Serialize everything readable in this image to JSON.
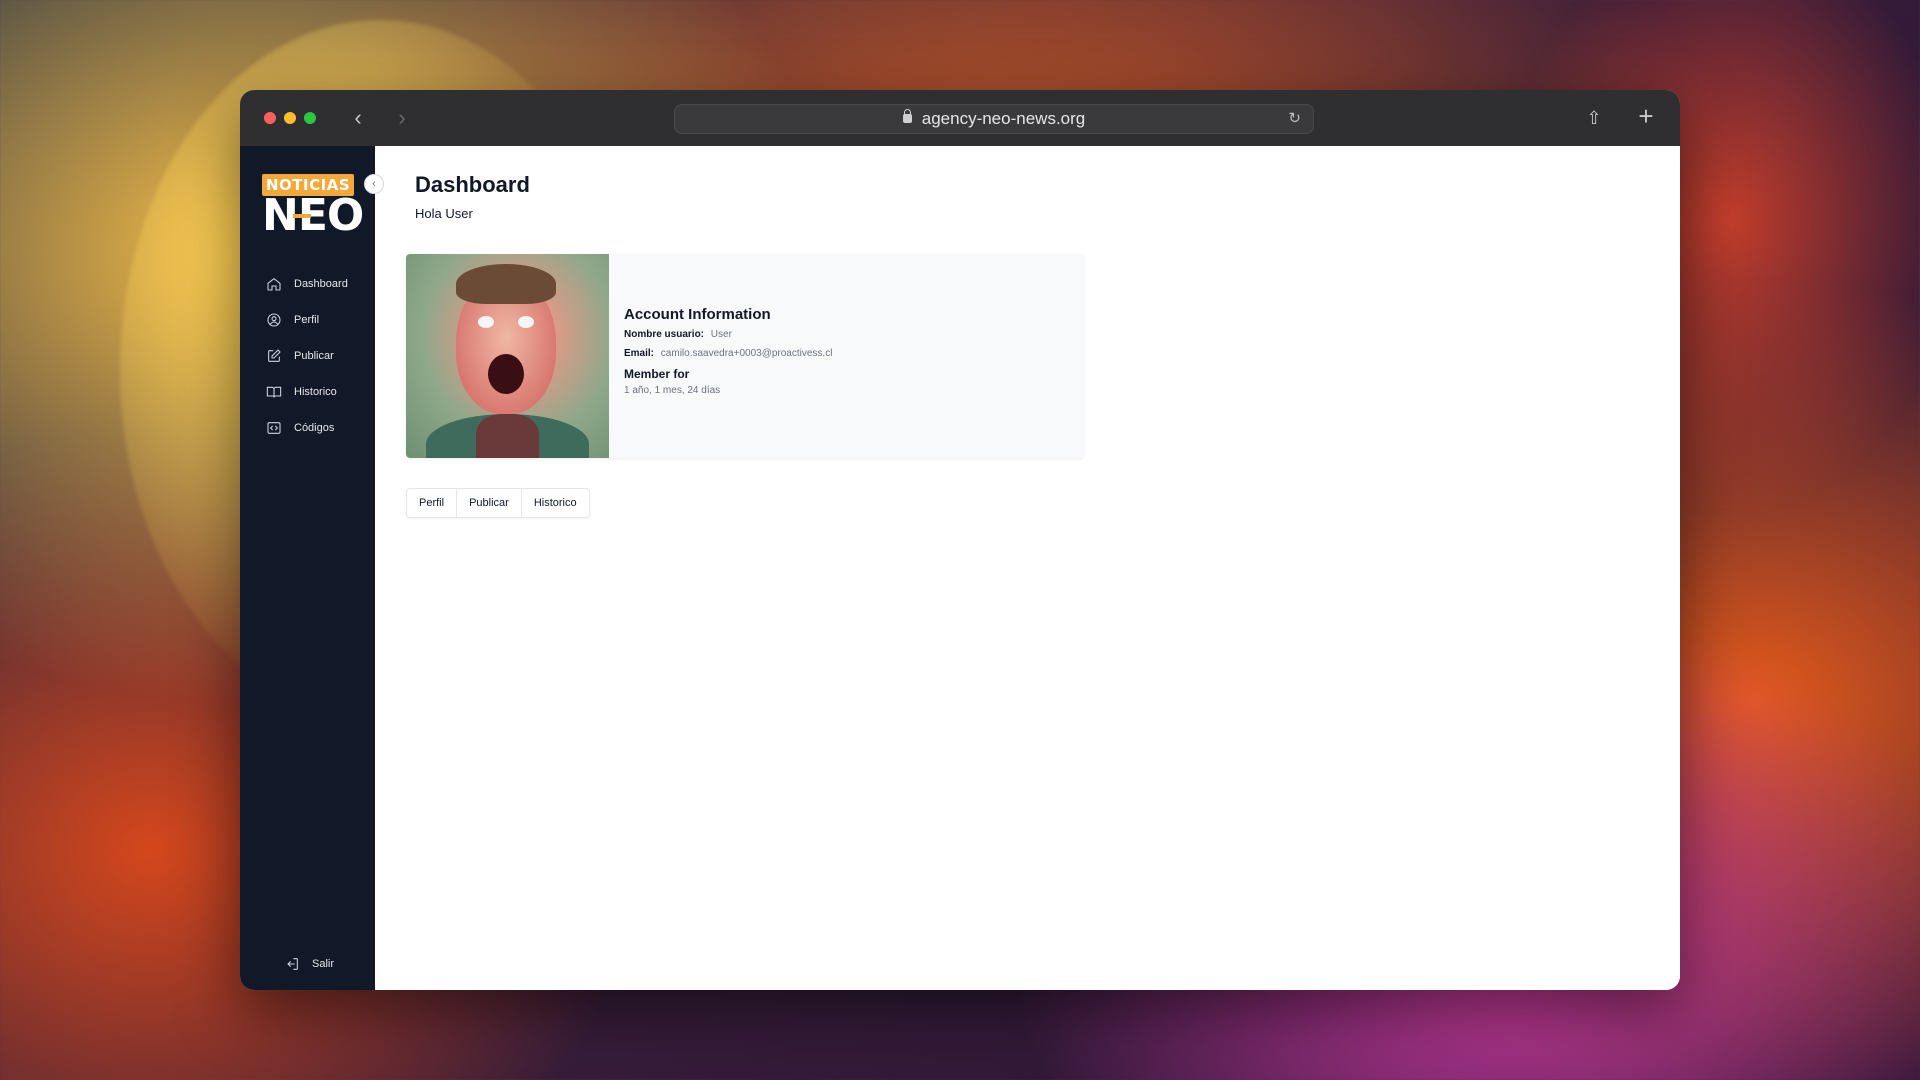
{
  "browser": {
    "url": "agency-neo-news.org",
    "back_icon": "chevron-left-icon",
    "forward_icon": "chevron-right-icon",
    "reload_icon": "reload-icon",
    "share_icon": "share-icon",
    "new_tab_icon": "plus-icon"
  },
  "sidebar": {
    "logo_top": "NOTICIAS",
    "logo_main": "NEO",
    "collapse_icon": "chevron-left-icon",
    "items": [
      {
        "label": "Dashboard",
        "icon": "home-icon"
      },
      {
        "label": "Perfil",
        "icon": "user-circle-icon"
      },
      {
        "label": "Publicar",
        "icon": "edit-icon"
      },
      {
        "label": "Historico",
        "icon": "book-icon"
      },
      {
        "label": "Códigos",
        "icon": "code-icon"
      }
    ],
    "logout_label": "Salir",
    "logout_icon": "logout-icon"
  },
  "main": {
    "title": "Dashboard",
    "greeting": "Hola User",
    "account": {
      "heading": "Account Information",
      "username_label": "Nombre usuario:",
      "username_value": "User",
      "email_label": "Email:",
      "email_value": "camilo.saavedra+0003@proactivess.cl",
      "member_label": "Member for",
      "member_value": "1 año, 1 mes, 24 días"
    },
    "tabs": [
      "Perfil",
      "Publicar",
      "Historico"
    ]
  },
  "colors": {
    "sidebar_bg": "#111827",
    "logo_accent": "#f2a93b"
  }
}
